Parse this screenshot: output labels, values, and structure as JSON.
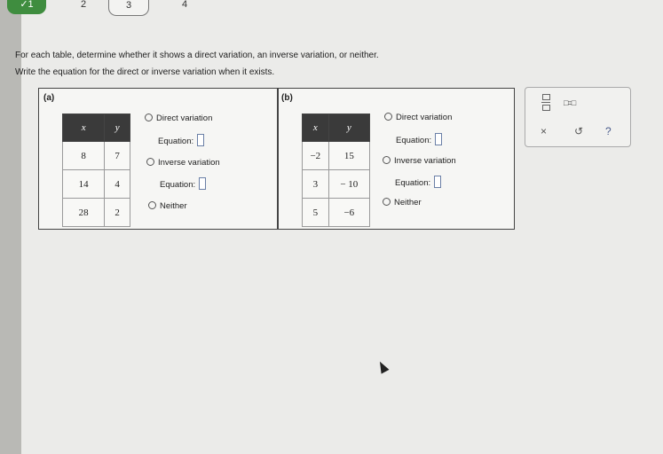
{
  "nav": {
    "steps": [
      {
        "label": "✓1",
        "state": "done"
      },
      {
        "label": "2",
        "state": "todo"
      },
      {
        "label": "3",
        "state": "current"
      },
      {
        "label": "4",
        "state": "todo"
      }
    ]
  },
  "instructions": {
    "line1": "For each table, determine whether it shows a direct variation, an inverse variation, or neither.",
    "line2": "Write the equation for the direct or inverse variation when it exists."
  },
  "parts": [
    {
      "label": "(a)",
      "headers": [
        "x",
        "y"
      ],
      "rows": [
        [
          "8",
          "7"
        ],
        [
          "14",
          "4"
        ],
        [
          "28",
          "2"
        ]
      ],
      "options": {
        "direct": "Direct variation",
        "equation_label": "Equation:",
        "inverse": "Inverse variation",
        "equation_label_2": "Equation:",
        "neither": "Neither"
      }
    },
    {
      "label": "(b)",
      "headers": [
        "x",
        "y"
      ],
      "rows": [
        [
          "−2",
          "15"
        ],
        [
          "3",
          "− 10"
        ],
        [
          "5",
          "−6"
        ]
      ],
      "options": {
        "direct": "Direct variation",
        "equation_label": "Equation:",
        "inverse": "Inverse variation",
        "equation_label_2": "Equation:",
        "neither": "Neither"
      }
    }
  ],
  "toolbox": {
    "fraction_icon": "fraction-icon",
    "mixed_number_icon": "mixed-number-icon",
    "mixed_number_text": "□=□",
    "clear_symbol": "×",
    "undo_symbol": "↺",
    "help_symbol": "?"
  },
  "colors": {
    "table_header_bg": "#3a3a3a",
    "done_step": "#3f8d3f",
    "help_accent": "#4a5c8c"
  }
}
